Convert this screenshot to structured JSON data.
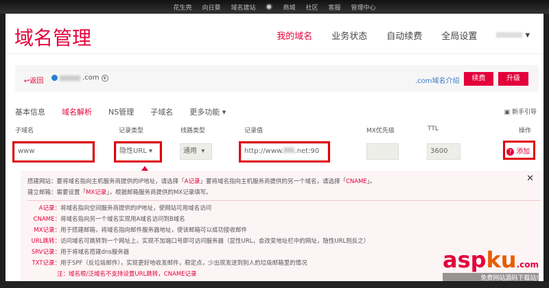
{
  "topbar": {
    "items": [
      "花生壳",
      "向日葵",
      "域名建站",
      "商城",
      "社区",
      "客服",
      "管理中心"
    ]
  },
  "header": {
    "title": "域名管理",
    "nav": [
      "我的域名",
      "业务状态",
      "自动续费",
      "全局设置"
    ]
  },
  "domain_bar": {
    "back": "↩返回",
    "domain_suffix": ".com",
    "intro": ".com域名介绍",
    "renew": "续费",
    "upgrade": "升级"
  },
  "tabs": [
    "基本信息",
    "域名解析",
    "NS管理",
    "子域名",
    "更多功能 ▾"
  ],
  "guide": "新手引导",
  "table": {
    "headers": [
      "子域名",
      "记录类型",
      "线路类型",
      "记录值",
      "MX优先级",
      "TTL",
      "操作"
    ],
    "row": {
      "subdomain": "www",
      "type": "隐性URL",
      "line": "通用",
      "value_prefix": "http://www.",
      "value_suffix": ".net:90",
      "mx": "",
      "ttl": "3600",
      "action": "添加"
    }
  },
  "help": {
    "line1": [
      "搭建网站：要将域名指向主机服务商提供的IP地址，请选择「",
      "A记录",
      "」要将域名指向主机服务商提供的另一个域名，请选择「",
      "CNAME",
      "」。"
    ],
    "line2": [
      "建立邮箱：需要设置「",
      "MX记录",
      "」，根据邮箱服务商提供的MX记录填写。"
    ],
    "records": [
      {
        "k": "A记录：",
        "v": "将域名指向空间服务商提供的IP地址，使网站可用域名访问"
      },
      {
        "k": "CNAME：",
        "v": "将域名指向另一个域名实现用A域名访问到B域名"
      },
      {
        "k": "MX记录：",
        "v": "用于搭建邮箱，将域名指向邮件服务器地址，使该邮箱可以成功接收邮件"
      },
      {
        "k": "URL跳转：",
        "v": "访问域名可跳转到一个网址上，实现不加端口号即可访问服务器（显性URL，会改变地址栏中的网址，隐性URL则反之）"
      },
      {
        "k": "SRV记录：",
        "v": "用于将域名搭建dns服务器"
      },
      {
        "k": "TXT记录：",
        "v": "用于SPF（反垃圾邮件），实现更好地收发邮件，稳定点，少出现发送到别人的垃圾邮箱里的情况"
      }
    ],
    "note_k": "注：",
    "note": "域名根/泛域名不支持设置URL跳转，CNAME记录"
  },
  "watermark": {
    "brand_a": "asp",
    "brand_b": "ku",
    "brand_c": ".com",
    "tagline": "免费网站源码下载站!"
  },
  "colors": {
    "accent": "#e4003a",
    "highlight_box": "#e0000a"
  }
}
